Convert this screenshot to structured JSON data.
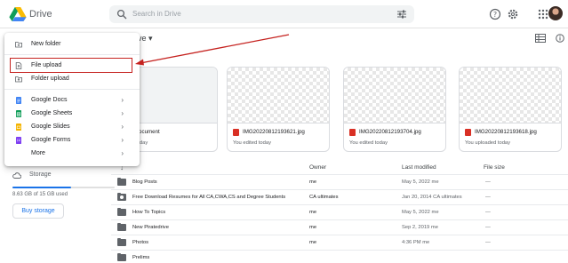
{
  "header": {
    "app_name": "Drive",
    "search_placeholder": "Search in Drive"
  },
  "toolbar": {
    "breadcrumb": "ve ▾"
  },
  "new_menu": {
    "items": [
      {
        "label": "New folder",
        "icon": "new-folder-icon"
      },
      {
        "label": "File upload",
        "icon": "file-upload-icon"
      },
      {
        "label": "Folder upload",
        "icon": "folder-upload-icon"
      },
      {
        "label": "Google Docs",
        "icon": "google-docs-icon",
        "color": "#4285f4"
      },
      {
        "label": "Google Sheets",
        "icon": "google-sheets-icon",
        "color": "#0f9d58"
      },
      {
        "label": "Google Slides",
        "icon": "google-slides-icon",
        "color": "#f4b400"
      },
      {
        "label": "Google Forms",
        "icon": "google-forms-icon",
        "color": "#7e3ff2"
      },
      {
        "label": "More",
        "icon": ""
      }
    ],
    "chevron": "›"
  },
  "sidebar": {
    "storage_label": "Storage",
    "storage_used_fraction": 0.575,
    "storage_text": "8.63 GB of 15 GB used",
    "buy_storage": "Buy storage"
  },
  "suggested": [
    {
      "title": "ed document",
      "sub": "ed today",
      "thumb": "plain"
    },
    {
      "title": "IMG20220812193621.jpg",
      "sub": "You edited today",
      "thumb": "checker"
    },
    {
      "title": "IMG20220812193704.jpg",
      "sub": "You edited today",
      "thumb": "checker"
    },
    {
      "title": "IMG20220812193618.jpg",
      "sub": "You uploaded today",
      "thumb": "checker"
    }
  ],
  "table": {
    "headers": {
      "owner": "Owner",
      "last_modified": "Last modified",
      "file_size": "File size"
    },
    "sort_arrow": "↓",
    "rows": [
      {
        "name": "Blog Posts",
        "owner": "me",
        "modified": "May 5, 2022 me",
        "size": "—",
        "shared": false
      },
      {
        "name": "Free Download Resumes for All CA,CWA,CS and Degree Students",
        "owner": "CA ultimates",
        "modified": "Jan 20, 2014 CA ultimates",
        "size": "—",
        "shared": true
      },
      {
        "name": "How To Topics",
        "owner": "me",
        "modified": "May 5, 2022 me",
        "size": "—",
        "shared": false
      },
      {
        "name": "New Piratedrive",
        "owner": "me",
        "modified": "Sep 2, 2019 me",
        "size": "—",
        "shared": false
      },
      {
        "name": "Photos",
        "owner": "me",
        "modified": "4:36 PM me",
        "size": "—",
        "shared": false
      },
      {
        "name": "Prelims",
        "owner": "",
        "modified": "",
        "size": "",
        "shared": false
      }
    ]
  },
  "colors": {
    "accent": "#1a73e8",
    "highlight_red": "#c5221f"
  }
}
